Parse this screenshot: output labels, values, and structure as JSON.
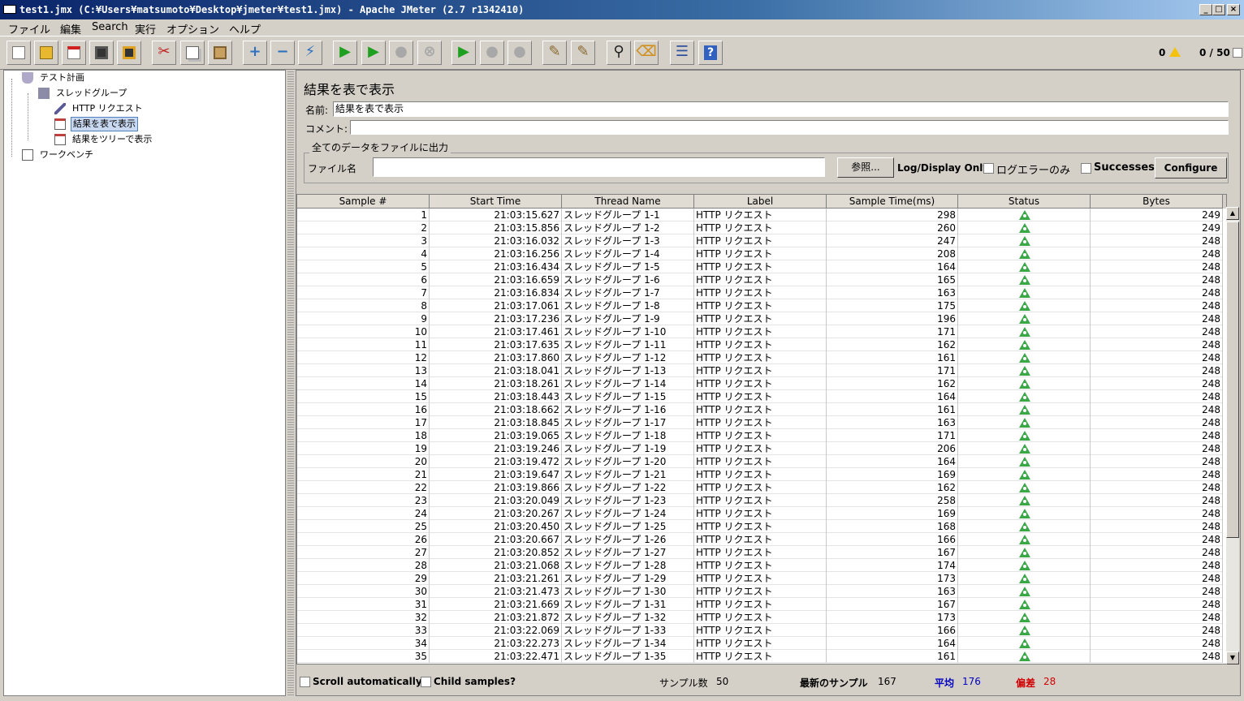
{
  "window": {
    "title": "test1.jmx (C:¥Users¥matsumoto¥Desktop¥jmeter¥test1.jmx) - Apache JMeter (2.7 r1342410)",
    "minimize": "_",
    "maximize": "□",
    "close": "×"
  },
  "menu": [
    "ファイル",
    "編集",
    "Search",
    "実行",
    "オプション",
    "ヘルプ"
  ],
  "toolbar": {
    "buttons": [
      {
        "icon": "new-icon",
        "glyph": ""
      },
      {
        "icon": "open-icon",
        "glyph": ""
      },
      {
        "icon": "close-file-icon",
        "glyph": ""
      },
      {
        "icon": "save-icon",
        "glyph": ""
      },
      {
        "icon": "save-as-icon",
        "glyph": ""
      },
      {
        "icon": "cut-icon",
        "glyph": "✂"
      },
      {
        "icon": "copy-icon",
        "glyph": ""
      },
      {
        "icon": "paste-icon",
        "glyph": ""
      },
      {
        "icon": "expand-icon",
        "glyph": "+"
      },
      {
        "icon": "collapse-icon",
        "glyph": "−"
      },
      {
        "icon": "toggle-icon",
        "glyph": "⚡"
      },
      {
        "icon": "start-icon",
        "glyph": "▶"
      },
      {
        "icon": "start-no-pause-icon",
        "glyph": "▶"
      },
      {
        "icon": "stop-icon",
        "glyph": "●"
      },
      {
        "icon": "shutdown-icon",
        "glyph": "⊗"
      },
      {
        "icon": "remote-start-icon",
        "glyph": "▶"
      },
      {
        "icon": "remote-stop-icon",
        "glyph": "●"
      },
      {
        "icon": "remote-shutdown-icon",
        "glyph": "●"
      },
      {
        "icon": "clear-icon",
        "glyph": "✎"
      },
      {
        "icon": "clear-all-icon",
        "glyph": "✎"
      },
      {
        "icon": "search-icon",
        "glyph": "⚲"
      },
      {
        "icon": "reset-search-icon",
        "glyph": "⌫"
      },
      {
        "icon": "function-helper-icon",
        "glyph": "☰"
      },
      {
        "icon": "help-icon",
        "glyph": "?"
      }
    ],
    "error_count": "0",
    "threads": "0 / 50"
  },
  "tree": {
    "nodes": [
      {
        "label": "テスト計画",
        "icon": "test-plan-icon"
      },
      {
        "label": "スレッドグループ",
        "icon": "thread-group-icon"
      },
      {
        "label": "HTTP リクエスト",
        "icon": "http-request-icon"
      },
      {
        "label": "結果を表で表示",
        "icon": "table-results-icon"
      },
      {
        "label": "結果をツリーで表示",
        "icon": "tree-results-icon"
      },
      {
        "label": "ワークベンチ",
        "icon": "workbench-icon"
      }
    ]
  },
  "panel": {
    "title": "結果を表で表示",
    "name_label": "名前:",
    "name_value": "結果を表で表示",
    "comment_label": "コメント:",
    "comment_value": "",
    "group_title": "全てのデータをファイルに出力",
    "filename_label": "ファイル名",
    "filename_value": "",
    "browse_button": "参照...",
    "log_display_label": "Log/Display Only:",
    "errors_only_label": "ログエラーのみ",
    "successes_label": "Successes",
    "configure_button": "Configure"
  },
  "table": {
    "columns": [
      "Sample #",
      "Start Time",
      "Thread Name",
      "Label",
      "Sample Time(ms)",
      "Status",
      "Bytes"
    ],
    "rows": [
      {
        "n": "1",
        "start": "21:03:15.627",
        "thread": "スレッドグループ 1-1",
        "label": "HTTP リクエスト",
        "time": "298",
        "bytes": "249"
      },
      {
        "n": "2",
        "start": "21:03:15.856",
        "thread": "スレッドグループ 1-2",
        "label": "HTTP リクエスト",
        "time": "260",
        "bytes": "249"
      },
      {
        "n": "3",
        "start": "21:03:16.032",
        "thread": "スレッドグループ 1-3",
        "label": "HTTP リクエスト",
        "time": "247",
        "bytes": "248"
      },
      {
        "n": "4",
        "start": "21:03:16.256",
        "thread": "スレッドグループ 1-4",
        "label": "HTTP リクエスト",
        "time": "208",
        "bytes": "248"
      },
      {
        "n": "5",
        "start": "21:03:16.434",
        "thread": "スレッドグループ 1-5",
        "label": "HTTP リクエスト",
        "time": "164",
        "bytes": "248"
      },
      {
        "n": "6",
        "start": "21:03:16.659",
        "thread": "スレッドグループ 1-6",
        "label": "HTTP リクエスト",
        "time": "165",
        "bytes": "248"
      },
      {
        "n": "7",
        "start": "21:03:16.834",
        "thread": "スレッドグループ 1-7",
        "label": "HTTP リクエスト",
        "time": "163",
        "bytes": "248"
      },
      {
        "n": "8",
        "start": "21:03:17.061",
        "thread": "スレッドグループ 1-8",
        "label": "HTTP リクエスト",
        "time": "175",
        "bytes": "248"
      },
      {
        "n": "9",
        "start": "21:03:17.236",
        "thread": "スレッドグループ 1-9",
        "label": "HTTP リクエスト",
        "time": "196",
        "bytes": "248"
      },
      {
        "n": "10",
        "start": "21:03:17.461",
        "thread": "スレッドグループ 1-10",
        "label": "HTTP リクエスト",
        "time": "171",
        "bytes": "248"
      },
      {
        "n": "11",
        "start": "21:03:17.635",
        "thread": "スレッドグループ 1-11",
        "label": "HTTP リクエスト",
        "time": "162",
        "bytes": "248"
      },
      {
        "n": "12",
        "start": "21:03:17.860",
        "thread": "スレッドグループ 1-12",
        "label": "HTTP リクエスト",
        "time": "161",
        "bytes": "248"
      },
      {
        "n": "13",
        "start": "21:03:18.041",
        "thread": "スレッドグループ 1-13",
        "label": "HTTP リクエスト",
        "time": "171",
        "bytes": "248"
      },
      {
        "n": "14",
        "start": "21:03:18.261",
        "thread": "スレッドグループ 1-14",
        "label": "HTTP リクエスト",
        "time": "162",
        "bytes": "248"
      },
      {
        "n": "15",
        "start": "21:03:18.443",
        "thread": "スレッドグループ 1-15",
        "label": "HTTP リクエスト",
        "time": "164",
        "bytes": "248"
      },
      {
        "n": "16",
        "start": "21:03:18.662",
        "thread": "スレッドグループ 1-16",
        "label": "HTTP リクエスト",
        "time": "161",
        "bytes": "248"
      },
      {
        "n": "17",
        "start": "21:03:18.845",
        "thread": "スレッドグループ 1-17",
        "label": "HTTP リクエスト",
        "time": "163",
        "bytes": "248"
      },
      {
        "n": "18",
        "start": "21:03:19.065",
        "thread": "スレッドグループ 1-18",
        "label": "HTTP リクエスト",
        "time": "171",
        "bytes": "248"
      },
      {
        "n": "19",
        "start": "21:03:19.246",
        "thread": "スレッドグループ 1-19",
        "label": "HTTP リクエスト",
        "time": "206",
        "bytes": "248"
      },
      {
        "n": "20",
        "start": "21:03:19.472",
        "thread": "スレッドグループ 1-20",
        "label": "HTTP リクエスト",
        "time": "164",
        "bytes": "248"
      },
      {
        "n": "21",
        "start": "21:03:19.647",
        "thread": "スレッドグループ 1-21",
        "label": "HTTP リクエスト",
        "time": "169",
        "bytes": "248"
      },
      {
        "n": "22",
        "start": "21:03:19.866",
        "thread": "スレッドグループ 1-22",
        "label": "HTTP リクエスト",
        "time": "162",
        "bytes": "248"
      },
      {
        "n": "23",
        "start": "21:03:20.049",
        "thread": "スレッドグループ 1-23",
        "label": "HTTP リクエスト",
        "time": "258",
        "bytes": "248"
      },
      {
        "n": "24",
        "start": "21:03:20.267",
        "thread": "スレッドグループ 1-24",
        "label": "HTTP リクエスト",
        "time": "169",
        "bytes": "248"
      },
      {
        "n": "25",
        "start": "21:03:20.450",
        "thread": "スレッドグループ 1-25",
        "label": "HTTP リクエスト",
        "time": "168",
        "bytes": "248"
      },
      {
        "n": "26",
        "start": "21:03:20.667",
        "thread": "スレッドグループ 1-26",
        "label": "HTTP リクエスト",
        "time": "166",
        "bytes": "248"
      },
      {
        "n": "27",
        "start": "21:03:20.852",
        "thread": "スレッドグループ 1-27",
        "label": "HTTP リクエスト",
        "time": "167",
        "bytes": "248"
      },
      {
        "n": "28",
        "start": "21:03:21.068",
        "thread": "スレッドグループ 1-28",
        "label": "HTTP リクエスト",
        "time": "174",
        "bytes": "248"
      },
      {
        "n": "29",
        "start": "21:03:21.261",
        "thread": "スレッドグループ 1-29",
        "label": "HTTP リクエスト",
        "time": "173",
        "bytes": "248"
      },
      {
        "n": "30",
        "start": "21:03:21.473",
        "thread": "スレッドグループ 1-30",
        "label": "HTTP リクエスト",
        "time": "163",
        "bytes": "248"
      },
      {
        "n": "31",
        "start": "21:03:21.669",
        "thread": "スレッドグループ 1-31",
        "label": "HTTP リクエスト",
        "time": "167",
        "bytes": "248"
      },
      {
        "n": "32",
        "start": "21:03:21.872",
        "thread": "スレッドグループ 1-32",
        "label": "HTTP リクエスト",
        "time": "173",
        "bytes": "248"
      },
      {
        "n": "33",
        "start": "21:03:22.069",
        "thread": "スレッドグループ 1-33",
        "label": "HTTP リクエスト",
        "time": "166",
        "bytes": "248"
      },
      {
        "n": "34",
        "start": "21:03:22.273",
        "thread": "スレッドグループ 1-34",
        "label": "HTTP リクエスト",
        "time": "164",
        "bytes": "248"
      },
      {
        "n": "35",
        "start": "21:03:22.471",
        "thread": "スレッドグループ 1-35",
        "label": "HTTP リクエスト",
        "time": "161",
        "bytes": "248"
      }
    ]
  },
  "footer": {
    "scroll_auto_label": "Scroll automatically?",
    "child_samples_label": "Child samples?",
    "sample_count_label": "サンプル数",
    "sample_count": "50",
    "latest_sample_label": "最新のサンプル",
    "latest_sample": "167",
    "average_label": "平均",
    "average": "176",
    "deviation_label": "偏差",
    "deviation": "28"
  },
  "colors": {
    "average": "#0000c0",
    "deviation": "#d00000",
    "success": "#3aa648"
  }
}
